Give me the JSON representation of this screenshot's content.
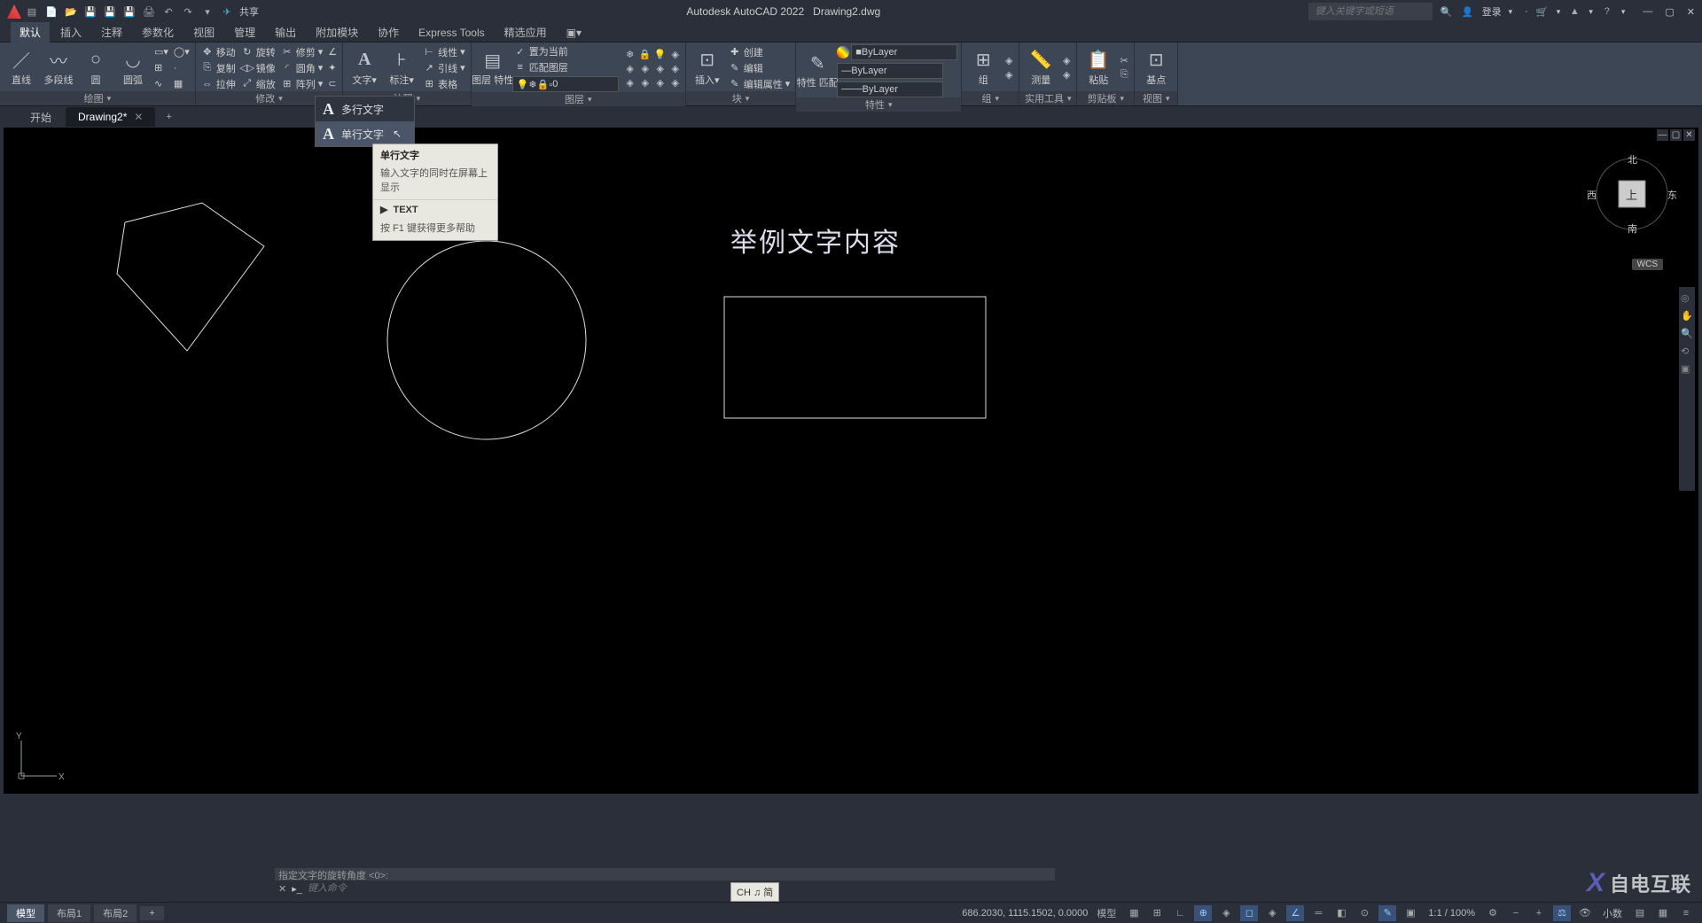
{
  "app": {
    "title": "Autodesk AutoCAD 2022",
    "document": "Drawing2.dwg",
    "share": "共享",
    "search_placeholder": "键入关键字或短语",
    "login": "登录"
  },
  "menuTabs": [
    "默认",
    "插入",
    "注释",
    "参数化",
    "视图",
    "管理",
    "输出",
    "附加模块",
    "协作",
    "Express Tools",
    "精选应用"
  ],
  "ribbon": {
    "draw": {
      "line": "直线",
      "polyline": "多段线",
      "circle": "圆",
      "arc": "圆弧",
      "label": "绘图"
    },
    "modify": {
      "move": "移动",
      "rotate": "旋转",
      "trim": "修剪",
      "copy": "复制",
      "mirror": "镜像",
      "fillet": "圆角",
      "stretch": "拉伸",
      "scale": "缩放",
      "array": "阵列",
      "label": "修改"
    },
    "annotation": {
      "text": "文字",
      "dim": "标注",
      "leader": "引线",
      "table": "表格",
      "linear": "线性",
      "label": "注释"
    },
    "layer": {
      "props": "图层\n特性",
      "current": "置为当前",
      "match": "匹配图层",
      "value": "0",
      "label": "图层"
    },
    "block": {
      "insert": "插入",
      "create": "创建",
      "edit": "编辑",
      "editattr": "编辑属性",
      "label": "块"
    },
    "props": {
      "match": "特性\n匹配",
      "layer": "ByLayer",
      "label": "特性"
    },
    "group": {
      "btn": "组",
      "label": "组"
    },
    "util": {
      "measure": "测量",
      "label": "实用工具"
    },
    "clip": {
      "paste": "粘贴",
      "label": "剪贴板"
    },
    "view": {
      "base": "基点",
      "label": "视图"
    }
  },
  "fileTabs": {
    "start": "开始",
    "drawing": "Drawing2*"
  },
  "textDropdown": {
    "mtext": "多行文字",
    "dtext": "单行文字"
  },
  "tooltip": {
    "title": "单行文字",
    "desc": "输入文字的同时在屏幕上显示",
    "cmd": "TEXT",
    "help": "按 F1 键获得更多帮助"
  },
  "canvas": {
    "sampleText": "举例文字内容",
    "viewcube": {
      "n": "北",
      "s": "南",
      "e": "东",
      "w": "西",
      "top": "上"
    },
    "wcs": "WCS"
  },
  "commandLine": {
    "history": "指定文字的旋转角度 <0>:",
    "placeholder": "键入命令"
  },
  "statusBar": {
    "model": "模型",
    "layout1": "布局1",
    "layout2": "布局2",
    "coords": "686.2030, 1115.1502, 0.0000",
    "modelBtn": "模型",
    "scale": "1:1 / 100%",
    "decimal": "小数",
    "ime": "CH ♫ 简"
  },
  "watermark": "自电互联"
}
